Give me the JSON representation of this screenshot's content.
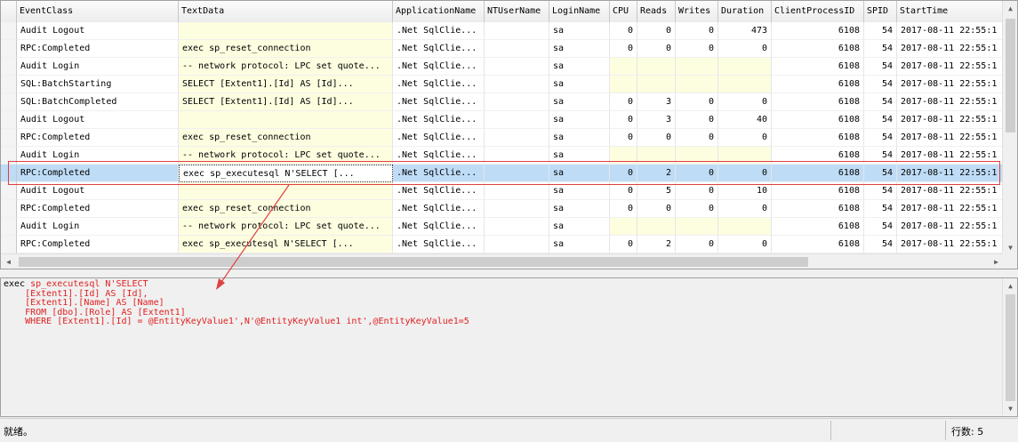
{
  "columns": [
    {
      "key": "sel",
      "label": "",
      "width": 18
    },
    {
      "key": "event_class",
      "label": "EventClass",
      "width": 182
    },
    {
      "key": "text_data",
      "label": "TextData",
      "width": 241
    },
    {
      "key": "application_name",
      "label": "ApplicationName",
      "width": 103
    },
    {
      "key": "nt_user_name",
      "label": "NTUserName",
      "width": 73
    },
    {
      "key": "login_name",
      "label": "LoginName",
      "width": 68
    },
    {
      "key": "cpu",
      "label": "CPU",
      "width": 31
    },
    {
      "key": "reads",
      "label": "Reads",
      "width": 43
    },
    {
      "key": "writes",
      "label": "Writes",
      "width": 48
    },
    {
      "key": "duration",
      "label": "Duration",
      "width": 60
    },
    {
      "key": "client_process_id",
      "label": "ClientProcessID",
      "width": 104
    },
    {
      "key": "spid",
      "label": "SPID",
      "width": 37
    },
    {
      "key": "start_time",
      "label": "StartTime",
      "width": 120
    }
  ],
  "rows": [
    {
      "event_class": "Audit Logout",
      "text_data": "",
      "application_name": ".Net SqlClie...",
      "nt_user_name": "",
      "login_name": "sa",
      "cpu": "0",
      "reads": "0",
      "writes": "0",
      "duration": "473",
      "client_process_id": "6108",
      "spid": "54",
      "start_time": "2017-08-11 22:55:1",
      "selected": false
    },
    {
      "event_class": "RPC:Completed",
      "text_data": "exec sp_reset_connection",
      "application_name": ".Net SqlClie...",
      "nt_user_name": "",
      "login_name": "sa",
      "cpu": "0",
      "reads": "0",
      "writes": "0",
      "duration": "0",
      "client_process_id": "6108",
      "spid": "54",
      "start_time": "2017-08-11 22:55:1",
      "selected": false
    },
    {
      "event_class": "Audit Login",
      "text_data": "-- network protocol: LPC  set quote...",
      "application_name": ".Net SqlClie...",
      "nt_user_name": "",
      "login_name": "sa",
      "cpu": "",
      "reads": "",
      "writes": "",
      "duration": "",
      "client_process_id": "6108",
      "spid": "54",
      "start_time": "2017-08-11 22:55:1",
      "selected": false
    },
    {
      "event_class": "SQL:BatchStarting",
      "text_data": "SELECT       [Extent1].[Id] AS [Id]...",
      "application_name": ".Net SqlClie...",
      "nt_user_name": "",
      "login_name": "sa",
      "cpu": "",
      "reads": "",
      "writes": "",
      "duration": "",
      "client_process_id": "6108",
      "spid": "54",
      "start_time": "2017-08-11 22:55:1",
      "selected": false
    },
    {
      "event_class": "SQL:BatchCompleted",
      "text_data": "SELECT       [Extent1].[Id] AS [Id]...",
      "application_name": ".Net SqlClie...",
      "nt_user_name": "",
      "login_name": "sa",
      "cpu": "0",
      "reads": "3",
      "writes": "0",
      "duration": "0",
      "client_process_id": "6108",
      "spid": "54",
      "start_time": "2017-08-11 22:55:1",
      "selected": false
    },
    {
      "event_class": "Audit Logout",
      "text_data": "",
      "application_name": ".Net SqlClie...",
      "nt_user_name": "",
      "login_name": "sa",
      "cpu": "0",
      "reads": "3",
      "writes": "0",
      "duration": "40",
      "client_process_id": "6108",
      "spid": "54",
      "start_time": "2017-08-11 22:55:1",
      "selected": false
    },
    {
      "event_class": "RPC:Completed",
      "text_data": "exec sp_reset_connection",
      "application_name": ".Net SqlClie...",
      "nt_user_name": "",
      "login_name": "sa",
      "cpu": "0",
      "reads": "0",
      "writes": "0",
      "duration": "0",
      "client_process_id": "6108",
      "spid": "54",
      "start_time": "2017-08-11 22:55:1",
      "selected": false
    },
    {
      "event_class": "Audit Login",
      "text_data": "-- network protocol: LPC  set quote...",
      "application_name": ".Net SqlClie...",
      "nt_user_name": "",
      "login_name": "sa",
      "cpu": "",
      "reads": "",
      "writes": "",
      "duration": "",
      "client_process_id": "6108",
      "spid": "54",
      "start_time": "2017-08-11 22:55:1",
      "selected": false
    },
    {
      "event_class": "RPC:Completed",
      "text_data": "exec sp_executesql N'SELECT        [...",
      "application_name": ".Net SqlClie...",
      "nt_user_name": "",
      "login_name": "sa",
      "cpu": "0",
      "reads": "2",
      "writes": "0",
      "duration": "0",
      "client_process_id": "6108",
      "spid": "54",
      "start_time": "2017-08-11 22:55:1",
      "selected": true
    },
    {
      "event_class": "Audit Logout",
      "text_data": "",
      "application_name": ".Net SqlClie...",
      "nt_user_name": "",
      "login_name": "sa",
      "cpu": "0",
      "reads": "5",
      "writes": "0",
      "duration": "10",
      "client_process_id": "6108",
      "spid": "54",
      "start_time": "2017-08-11 22:55:1",
      "selected": false
    },
    {
      "event_class": "RPC:Completed",
      "text_data": "exec sp_reset_connection",
      "application_name": ".Net SqlClie...",
      "nt_user_name": "",
      "login_name": "sa",
      "cpu": "0",
      "reads": "0",
      "writes": "0",
      "duration": "0",
      "client_process_id": "6108",
      "spid": "54",
      "start_time": "2017-08-11 22:55:1",
      "selected": false
    },
    {
      "event_class": "Audit Login",
      "text_data": "-- network protocol: LPC  set quote...",
      "application_name": ".Net SqlClie...",
      "nt_user_name": "",
      "login_name": "sa",
      "cpu": "",
      "reads": "",
      "writes": "",
      "duration": "",
      "client_process_id": "6108",
      "spid": "54",
      "start_time": "2017-08-11 22:55:1",
      "selected": false
    },
    {
      "event_class": "RPC:Completed",
      "text_data": "exec sp_executesql N'SELECT        [...",
      "application_name": ".Net SqlClie...",
      "nt_user_name": "",
      "login_name": "sa",
      "cpu": "0",
      "reads": "2",
      "writes": "0",
      "duration": "0",
      "client_process_id": "6108",
      "spid": "54",
      "start_time": "2017-08-11 22:55:1",
      "selected": false
    }
  ],
  "text_pane": {
    "lines": [
      {
        "prefix": "exec ",
        "rest": "sp_executesql N'SELECT"
      },
      {
        "prefix": "    ",
        "rest": "[Extent1].[Id] AS [Id],"
      },
      {
        "prefix": "    ",
        "rest": "[Extent1].[Name] AS [Name]"
      },
      {
        "prefix": "    ",
        "rest": "FROM [dbo].[Role] AS [Extent1]"
      },
      {
        "prefix": "    ",
        "rest": "WHERE [Extent1].[Id] = @EntityKeyValue1',N'@EntityKeyValue1 int',@EntityKeyValue1=5"
      }
    ]
  },
  "status": {
    "text": "就绪。",
    "row_count_label": "行数: 5"
  },
  "colors": {
    "selected_row": "#bfdcf6",
    "text_data_bg": "#fdfde0",
    "highlight_red": "#e02020"
  }
}
